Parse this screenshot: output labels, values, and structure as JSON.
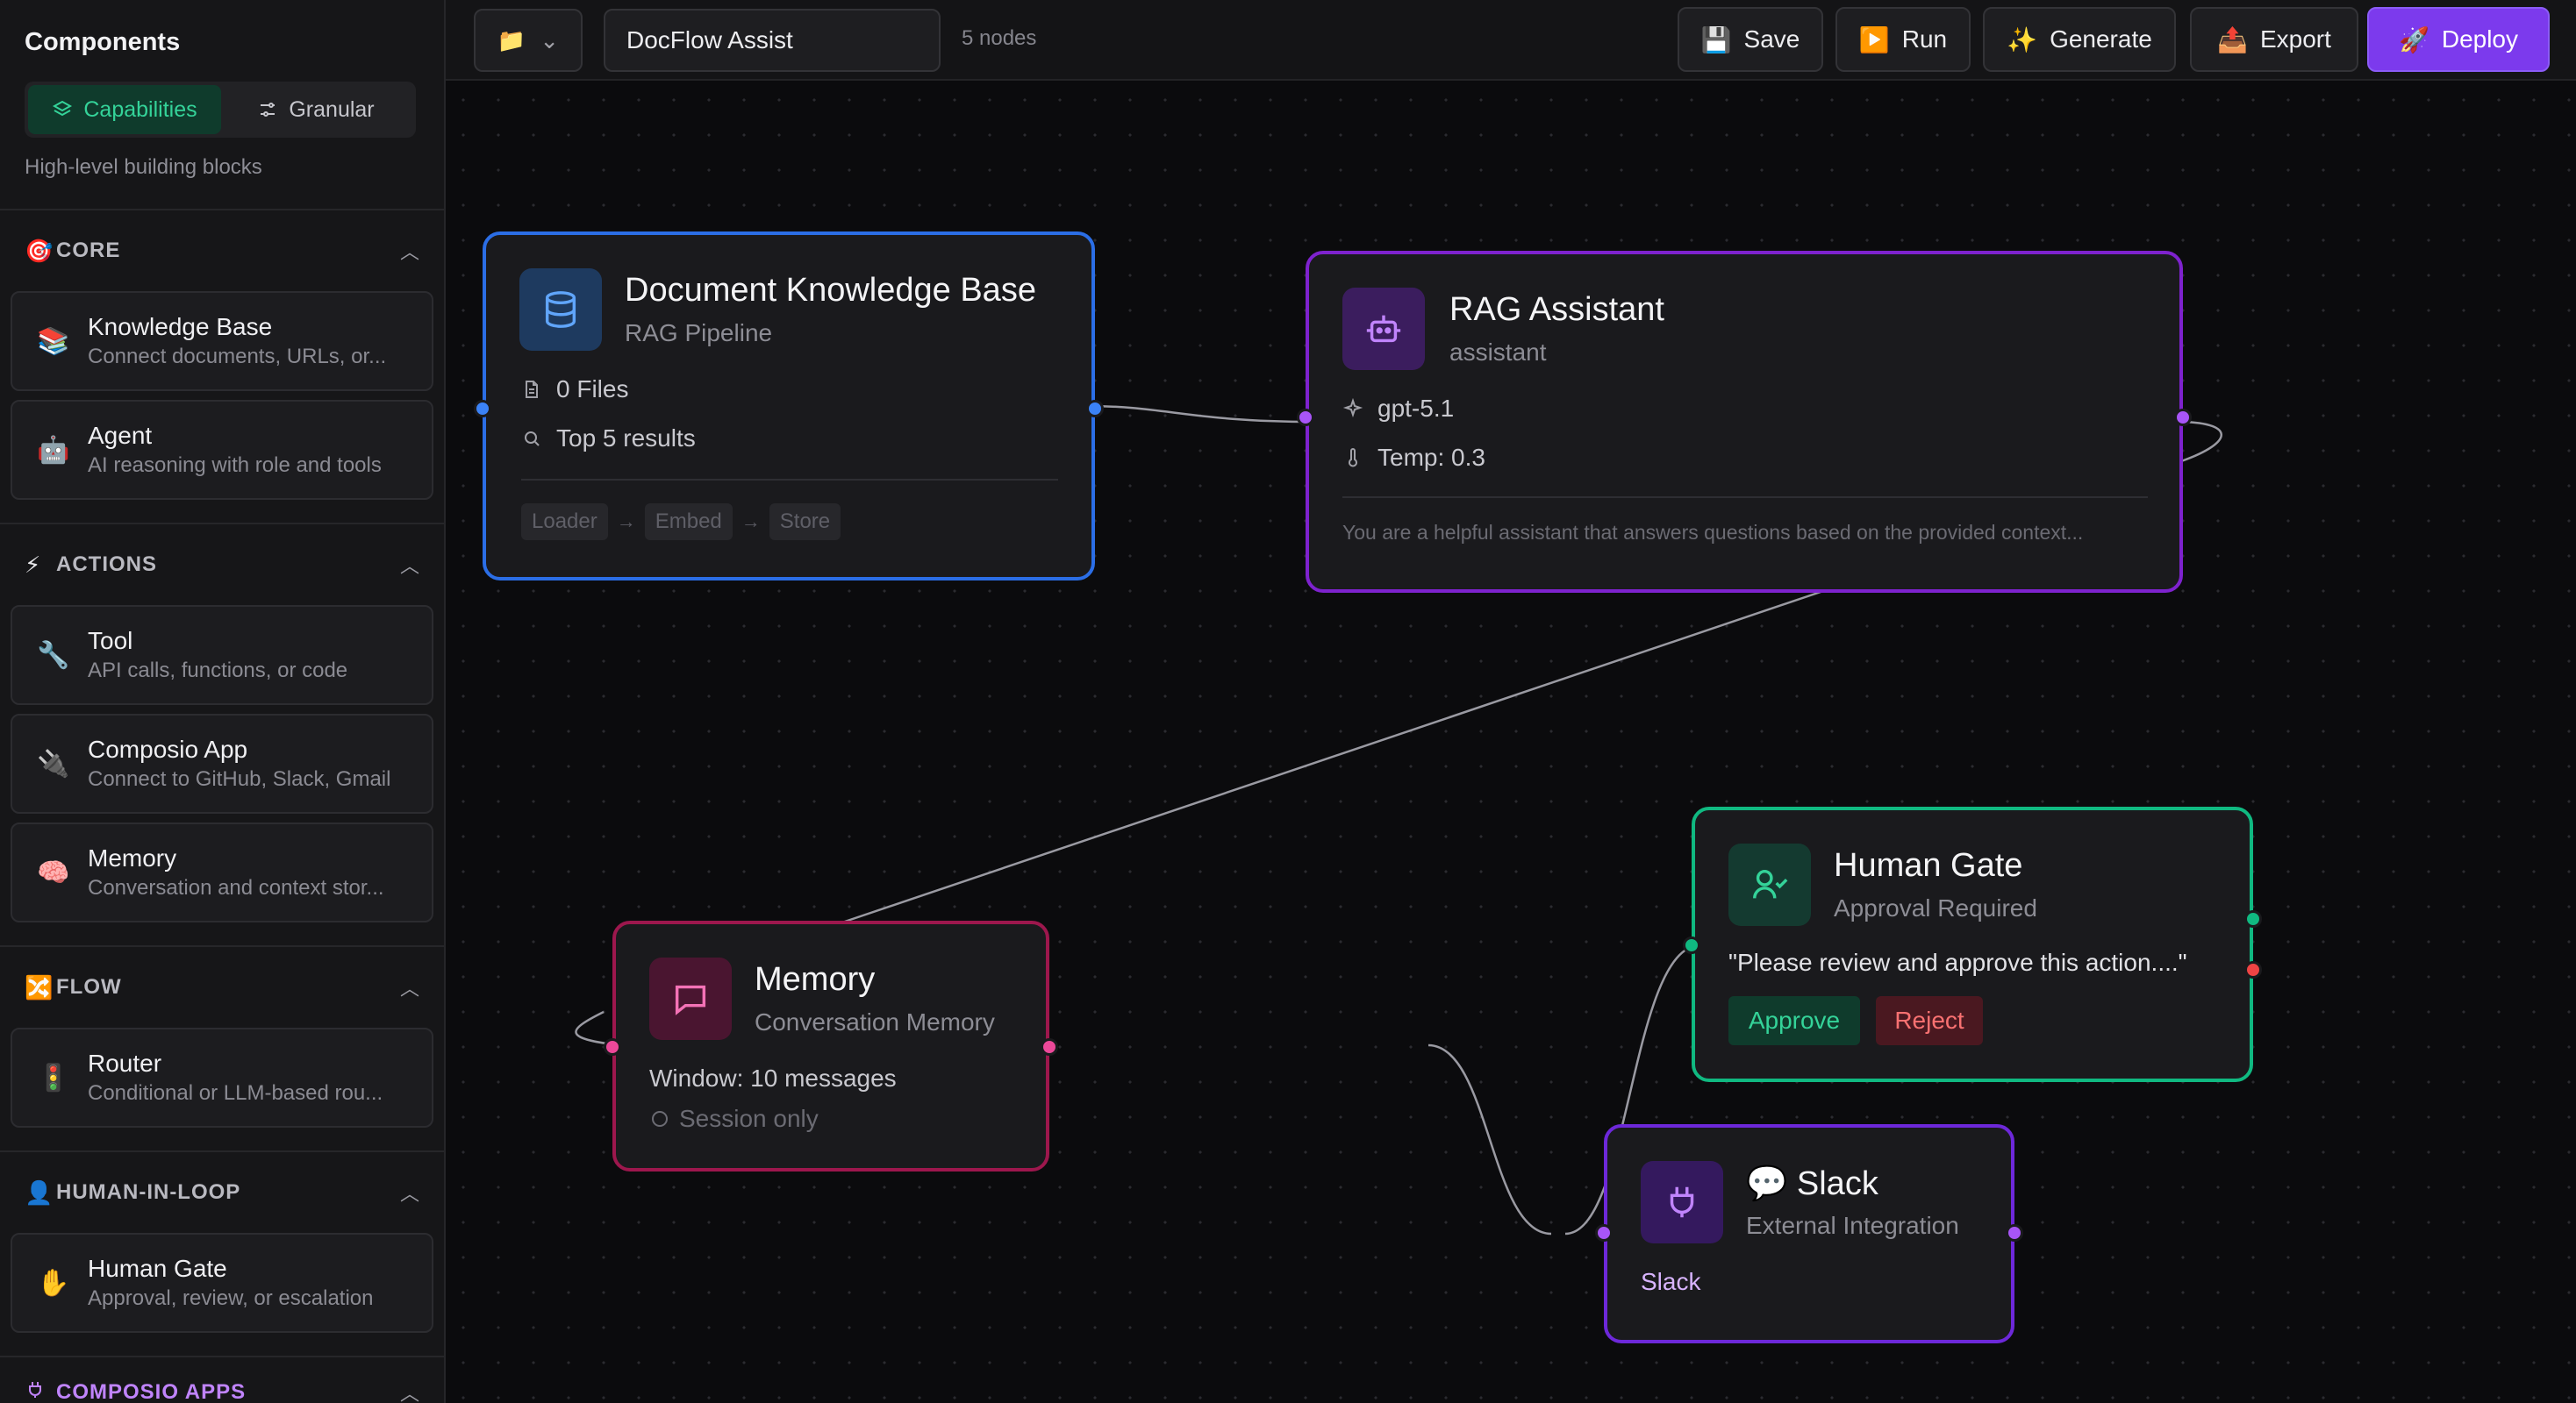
{
  "sidebar": {
    "title": "Components",
    "tabs": [
      {
        "label": "Capabilities",
        "active": true
      },
      {
        "label": "Granular",
        "active": false
      }
    ],
    "subtitle": "High-level building blocks",
    "sections": [
      {
        "key": "core",
        "icon": "🎯",
        "label": "CORE",
        "items": [
          {
            "icon": "📚",
            "title": "Knowledge Base",
            "desc": "Connect documents, URLs, or..."
          },
          {
            "icon": "🤖",
            "title": "Agent",
            "desc": "AI reasoning with role and tools"
          }
        ]
      },
      {
        "key": "actions",
        "icon": "⚡",
        "label": "ACTIONS",
        "items": [
          {
            "icon": "🔧",
            "title": "Tool",
            "desc": "API calls, functions, or code"
          },
          {
            "icon": "🔌",
            "title": "Composio App",
            "desc": "Connect to GitHub, Slack, Gmail"
          },
          {
            "icon": "🧠",
            "title": "Memory",
            "desc": "Conversation and context stor..."
          }
        ]
      },
      {
        "key": "flow",
        "icon": "🔀",
        "label": "FLOW",
        "items": [
          {
            "icon": "🚦",
            "title": "Router",
            "desc": "Conditional or LLM-based rou..."
          }
        ]
      },
      {
        "key": "human",
        "icon": "👤",
        "label": "HUMAN-IN-LOOP",
        "items": [
          {
            "icon": "✋",
            "title": "Human Gate",
            "desc": "Approval, review, or escalation"
          }
        ]
      },
      {
        "key": "composio",
        "icon": "plug-icon",
        "label": "COMPOSIO APPS",
        "items": []
      }
    ]
  },
  "toolbar": {
    "folder_icon": "📁",
    "workflow_name": "DocFlow Assist",
    "node_count": "5 nodes",
    "buttons": {
      "save": {
        "icon": "💾",
        "label": "Save"
      },
      "run": {
        "icon": "▶️",
        "label": "Run"
      },
      "generate": {
        "icon": "✨",
        "label": "Generate"
      },
      "export": {
        "icon": "📤",
        "label": "Export"
      },
      "deploy": {
        "icon": "🚀",
        "label": "Deploy"
      }
    }
  },
  "nodes": {
    "knowledge": {
      "title": "Document Knowledge Base",
      "subtitle": "RAG Pipeline",
      "files": "0 Files",
      "results": "Top 5 results",
      "pipeline": [
        "Loader",
        "Embed",
        "Store"
      ],
      "color": "#3b82f6"
    },
    "rag": {
      "title": "RAG Assistant",
      "subtitle": "assistant",
      "model": "gpt-5.1",
      "temp": "Temp: 0.3",
      "prompt": "You are a helpful assistant that answers questions based on the provided context...",
      "color": "#9333ea"
    },
    "memory": {
      "title": "Memory",
      "subtitle": "Conversation Memory",
      "window": "Window: 10 messages",
      "scope": "Session only",
      "color": "#db2777"
    },
    "slack": {
      "title_emoji": "💬",
      "title": "Slack",
      "subtitle": "External Integration",
      "app": "Slack",
      "color": "#7c3aed"
    },
    "gate": {
      "title": "Human Gate",
      "subtitle": "Approval Required",
      "message": "\"Please review and approve this action....\"",
      "approve": "Approve",
      "reject": "Reject",
      "color": "#10b981"
    }
  }
}
